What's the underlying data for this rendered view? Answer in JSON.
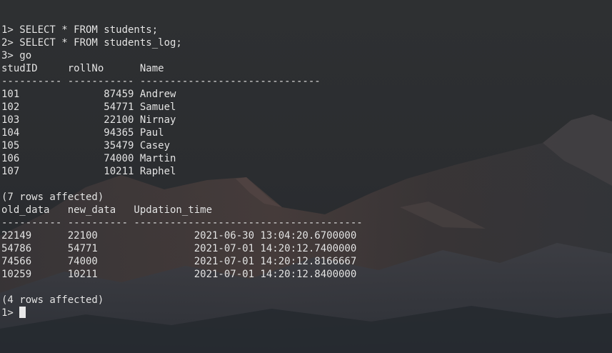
{
  "terminal": {
    "lines": [
      "1> SELECT * FROM students;",
      "2> SELECT * FROM students_log;",
      "3> go",
      "studID     rollNo      Name",
      "---------- ----------- ------------------------------",
      "101              87459 Andrew",
      "102              54771 Samuel",
      "103              22100 Nirnay",
      "104              94365 Paul",
      "105              35479 Casey",
      "106              74000 Martin",
      "107              10211 Raphel",
      "",
      "(7 rows affected)",
      "old_data   new_data   Updation_time",
      "---------- ---------- --------------------------------------",
      "22149      22100                2021-06-30 13:04:20.6700000",
      "54786      54771                2021-07-01 14:20:12.7400000",
      "74566      74000                2021-07-01 14:20:12.8166667",
      "10259      10211                2021-07-01 14:20:12.8400000",
      "",
      "(4 rows affected)"
    ],
    "prompt": "1> "
  },
  "colors": {
    "text": "#e6e6e6",
    "background": "#2b2d2f",
    "cursor": "#e8e8e8"
  }
}
